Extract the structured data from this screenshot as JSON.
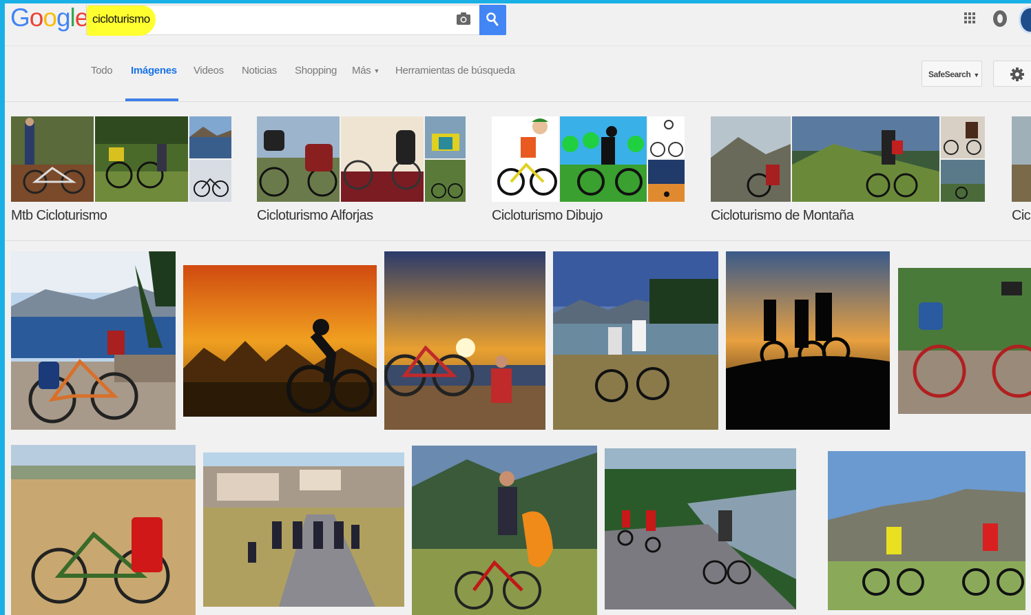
{
  "logo": {
    "letters": [
      "G",
      "o",
      "o",
      "g",
      "l",
      "e"
    ],
    "colors": [
      "#4285f4",
      "#ea4335",
      "#fbbc05",
      "#4285f4",
      "#34a853",
      "#ea4335"
    ]
  },
  "search": {
    "query": "cicloturismo",
    "highlight_color": "#ffff30",
    "button_color": "#4285f4"
  },
  "header_icons": [
    "apps-icon",
    "notifications-icon",
    "account-avatar"
  ],
  "tabs": [
    {
      "label": "Todo",
      "active": false
    },
    {
      "label": "Imágenes",
      "active": true
    },
    {
      "label": "Videos",
      "active": false
    },
    {
      "label": "Noticias",
      "active": false
    },
    {
      "label": "Shopping",
      "active": false
    },
    {
      "label": "Más",
      "active": false
    },
    {
      "label": "Herramientas de búsqueda",
      "active": false
    }
  ],
  "safesearch_label": "SafeSearch",
  "related_searches": [
    {
      "label": "Mtb Cicloturismo"
    },
    {
      "label": "Cicloturismo Alforjas"
    },
    {
      "label": "Cicloturismo Dibujo"
    },
    {
      "label": "Cicloturismo de Montaña"
    },
    {
      "label": "Cicl"
    }
  ],
  "results": {
    "row1_count": 6,
    "row2_count": 5
  },
  "colors": {
    "accent": "#1a73e8",
    "frame": "#1ab0e6",
    "background": "#f1f1f1"
  }
}
